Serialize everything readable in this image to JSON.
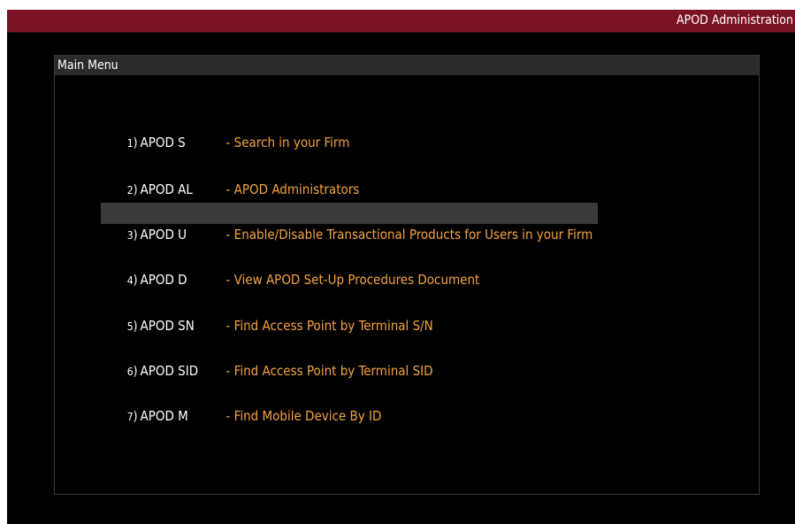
{
  "window": {
    "title": "APOD Administration"
  },
  "main_menu": {
    "title": "Main Menu",
    "items": [
      {
        "number": "1",
        "command": "APOD S",
        "description": "- Search in your Firm"
      },
      {
        "number": "2",
        "command": "APOD AL",
        "description": "- APOD Administrators"
      },
      {
        "number": "3",
        "command": "APOD U",
        "description": "- Enable/Disable Transactional Products for Users in your Firm"
      },
      {
        "number": "4",
        "command": "APOD D",
        "description": "- View APOD Set-Up Procedures Document"
      },
      {
        "number": "5",
        "command": "APOD SN",
        "description": "- Find Access Point by Terminal S/N"
      },
      {
        "number": "6",
        "command": "APOD SID",
        "description": "- Find Access Point by Terminal SID"
      },
      {
        "number": "7",
        "command": "APOD M",
        "description": "- Find Mobile Device By ID"
      }
    ],
    "selected_index": 2
  },
  "colors": {
    "title_bar": "#7a1424",
    "background": "#000000",
    "header_bar": "#2b2b2b",
    "selection": "#3a3a3a",
    "description_text": "#f4a340",
    "command_text": "#ffffff"
  }
}
